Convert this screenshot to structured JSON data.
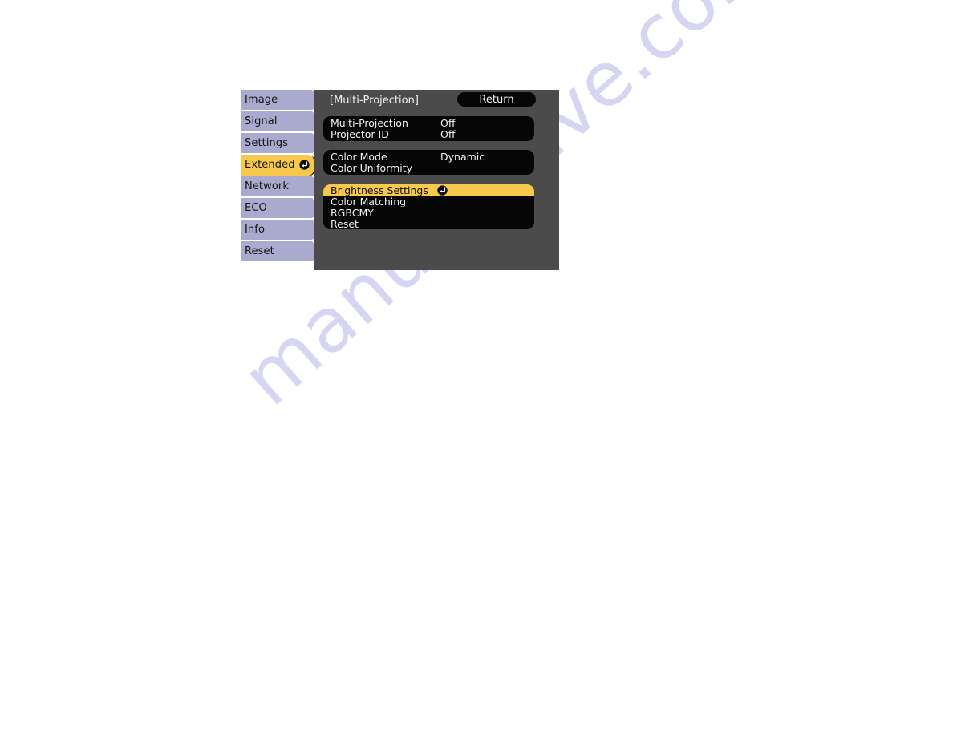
{
  "osd": {
    "sidebar": {
      "items": [
        {
          "label": "Image",
          "active": false,
          "enter_icon": ""
        },
        {
          "label": "Signal",
          "active": false,
          "enter_icon": ""
        },
        {
          "label": "Settings",
          "active": false,
          "enter_icon": ""
        },
        {
          "label": "Extended",
          "active": true,
          "enter_icon": "enter-key-icon"
        },
        {
          "label": "Network",
          "active": false,
          "enter_icon": ""
        },
        {
          "label": "ECO",
          "active": false,
          "enter_icon": ""
        },
        {
          "label": "Info",
          "active": false,
          "enter_icon": ""
        },
        {
          "label": "Reset",
          "active": false,
          "enter_icon": ""
        }
      ]
    },
    "header": {
      "title": "[Multi-Projection]",
      "return_label": "Return"
    },
    "groups": [
      {
        "rows": [
          {
            "label": "Multi-Projection",
            "value": "Off",
            "selected": false
          },
          {
            "label": "Projector ID",
            "value": "Off",
            "selected": false
          }
        ]
      },
      {
        "rows": [
          {
            "label": "Color Mode",
            "value": "Dynamic",
            "selected": false
          },
          {
            "label": "Color Uniformity",
            "value": "",
            "selected": false
          }
        ]
      },
      {
        "rows": [
          {
            "label": "Brightness Settings",
            "value": "",
            "selected": true,
            "enter_icon": "enter-key-icon"
          },
          {
            "label": "Color Matching",
            "value": "",
            "selected": false,
            "enter_icon": ""
          },
          {
            "label": "RGBCMY",
            "value": "",
            "selected": false,
            "enter_icon": ""
          },
          {
            "label": "Reset",
            "value": "",
            "selected": false,
            "enter_icon": ""
          }
        ]
      }
    ],
    "colors": {
      "panel_bg": "#4b4b4b",
      "tab_bg": "#aaaace",
      "highlight": "#f6c84c",
      "row_bg": "#060606",
      "text_light": "#f4f4f4"
    }
  },
  "watermark": {
    "text": "manualshive.com",
    "color": "#d6d6f2"
  }
}
